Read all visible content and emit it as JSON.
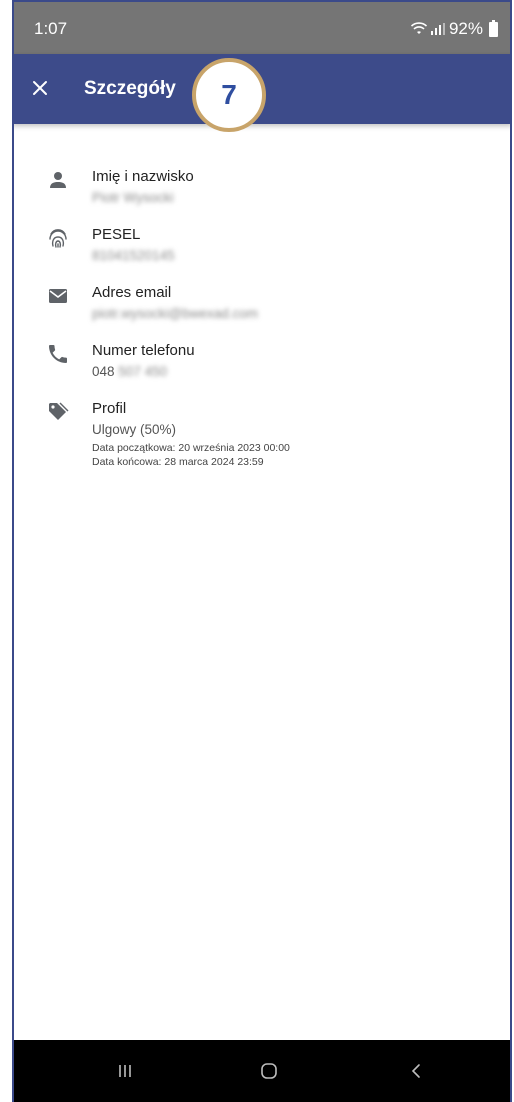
{
  "status_bar": {
    "time": "1:07",
    "battery": "92%",
    "icons": [
      "wifi-icon",
      "signal-icon",
      "battery-icon"
    ]
  },
  "app_bar": {
    "title": "Szczegóły",
    "close_icon": "close-icon"
  },
  "step_badge": "7",
  "details": [
    {
      "icon": "person-icon",
      "label": "Imię i nazwisko",
      "value": "Piotr Wysocki"
    },
    {
      "icon": "fingerprint-icon",
      "label": "PESEL",
      "value": "81041520145"
    },
    {
      "icon": "email-icon",
      "label": "Adres email",
      "value": "piotr.wysocki@bwexad.com"
    },
    {
      "icon": "phone-icon",
      "label": "Numer telefonu",
      "value_visible": "048",
      "value_hidden": "507 450"
    },
    {
      "icon": "tag-icon",
      "label": "Profil",
      "value": "Ulgowy (50%)",
      "start_date": "Data początkowa: 20 września 2023 00:00",
      "end_date": "Data końcowa: 28 marca 2024 23:59"
    }
  ],
  "colors": {
    "status_bar": "#757575",
    "app_bar": "#3d4b8a",
    "badge_border": "#c8a46a",
    "badge_text": "#2f4ea0",
    "icon": "#5f6368"
  },
  "nav": [
    "recent-apps-icon",
    "home-icon",
    "back-icon"
  ]
}
